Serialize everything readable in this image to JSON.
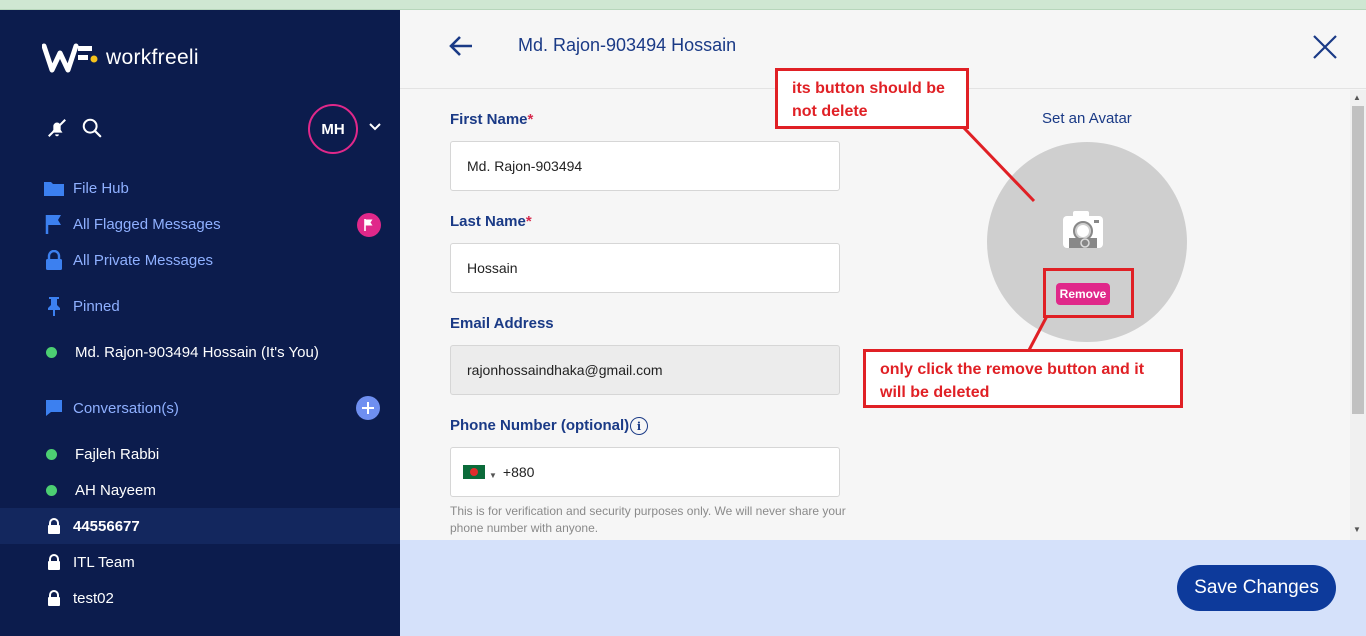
{
  "app": {
    "name": "workfreeli"
  },
  "sidebar": {
    "profile_initials": "MH",
    "items": [
      {
        "label": "File Hub",
        "icon": "folder-icon"
      },
      {
        "label": "All Flagged Messages",
        "icon": "flag-icon"
      },
      {
        "label": "All Private Messages",
        "icon": "lock-icon"
      },
      {
        "label": "Pinned",
        "icon": "pin-icon"
      }
    ],
    "self_user": "Md. Rajon-903494 Hossain (It's You)",
    "conversations_label": "Conversation(s)",
    "conversations": [
      {
        "label": "Fajleh Rabbi",
        "type": "online"
      },
      {
        "label": "AH Nayeem",
        "type": "online"
      },
      {
        "label": "44556677",
        "type": "locked",
        "active": true
      },
      {
        "label": "ITL Team",
        "type": "locked"
      },
      {
        "label": "test02",
        "type": "locked"
      }
    ]
  },
  "header": {
    "title": "Md. Rajon-903494 Hossain"
  },
  "form": {
    "first_name_label": "First Name",
    "first_name_value": "Md. Rajon-903494",
    "last_name_label": "Last Name",
    "last_name_value": "Hossain",
    "required_mark": "*",
    "email_label": "Email Address",
    "email_value": "rajonhossaindhaka@gmail.com",
    "phone_label": "Phone Number (optional)",
    "phone_code": "+880",
    "info_glyph": "i",
    "helper_text": "This is for verification and security purposes only. We will never share your phone number with anyone."
  },
  "avatar": {
    "title": "Set an Avatar",
    "remove_label": "Remove"
  },
  "footer": {
    "save_label": "Save Changes"
  },
  "annotations": {
    "note_1": "its button should be not delete",
    "note_2": "only click the remove button and it will be deleted"
  },
  "colors": {
    "sidebar_bg": "#0c1c4d",
    "accent_pink": "#e0288a",
    "primary_blue": "#0d3a9b",
    "annotation_red": "#e02025",
    "online_green": "#4ccf72"
  }
}
